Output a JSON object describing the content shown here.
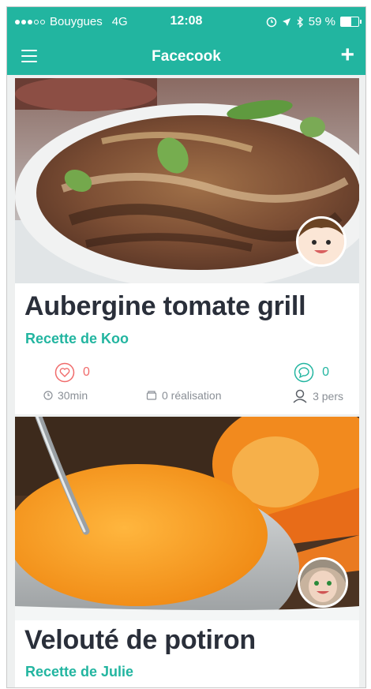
{
  "status_bar": {
    "carrier": "Bouygues",
    "network": "4G",
    "time": "12:08",
    "battery": "59 %",
    "battery_level": 0.59
  },
  "nav": {
    "title": "Facecook"
  },
  "recipes": [
    {
      "title": "Aubergine tomate grill",
      "author": "Recette de Koo",
      "likes": "0",
      "comments": "0",
      "time": "30min",
      "made": "0 réalisation",
      "people": "3 pers"
    },
    {
      "title": "Velouté de potiron",
      "author": "Recette de Julie"
    }
  ],
  "colors": {
    "accent": "#22b5a0",
    "like": "#f06b6b",
    "title": "#2a2f3a",
    "meta": "#8a8f96"
  }
}
